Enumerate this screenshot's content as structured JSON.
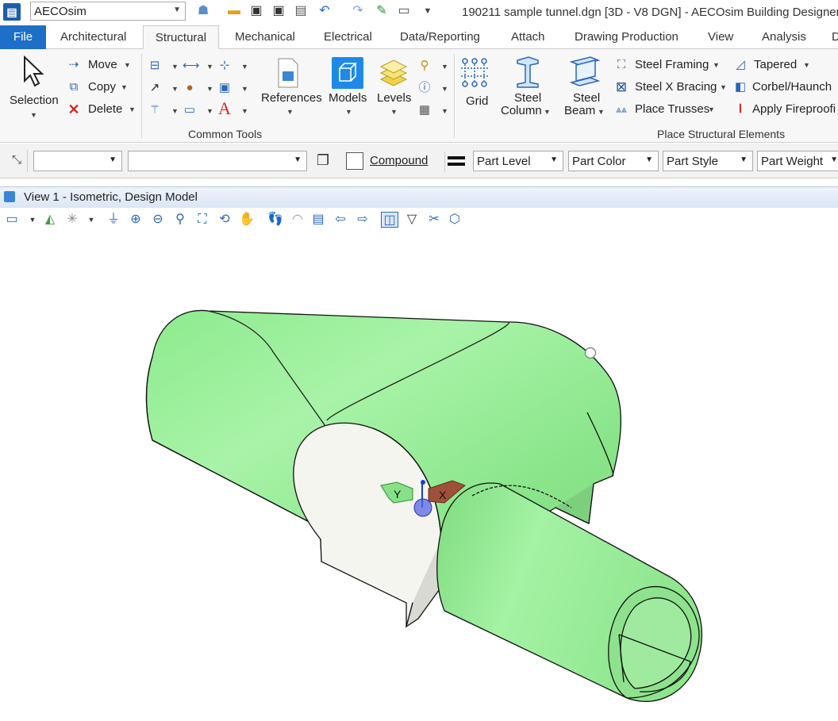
{
  "titlebar": {
    "workspace": "AECOsim",
    "title": "190211 sample tunnel.dgn [3D - V8 DGN] - AECOsim Building Designer"
  },
  "tabs": [
    "File",
    "Architectural",
    "Structural",
    "Mechanical",
    "Electrical",
    "Data/Reporting",
    "Attach",
    "Drawing Production",
    "View",
    "Analysis",
    "D"
  ],
  "active_tab": "Structural",
  "common_tools": {
    "selection": "Selection",
    "move": "Move",
    "copy": "Copy",
    "delete": "Delete",
    "references": "References",
    "models": "Models",
    "levels": "Levels",
    "group_label": "Common Tools"
  },
  "structural": {
    "grid": "Grid",
    "steel_column_1": "Steel",
    "steel_column_2": "Column",
    "steel_beam_1": "Steel",
    "steel_beam_2": "Beam",
    "steel_framing": "Steel Framing",
    "steel_x_bracing": "Steel X Bracing",
    "place_trusses": "Place Trusses",
    "tapered": "Tapered",
    "corbel_haunch": "Corbel/Haunch",
    "apply_fireproofing": "Apply Fireproofi",
    "group_label": "Place Structural Elements"
  },
  "attributes": {
    "compound": "Compound",
    "part_level": "Part Level",
    "part_color": "Part Color",
    "part_style": "Part Style",
    "part_weight": "Part Weight"
  },
  "view": {
    "title": "View 1 - Isometric, Design Model"
  },
  "colors": {
    "file_tab": "#1e6fc7",
    "tunnel_fill": "#90ee90",
    "tunnel_shade": "#7bd87b",
    "cut_face": "#f7f7f3"
  }
}
